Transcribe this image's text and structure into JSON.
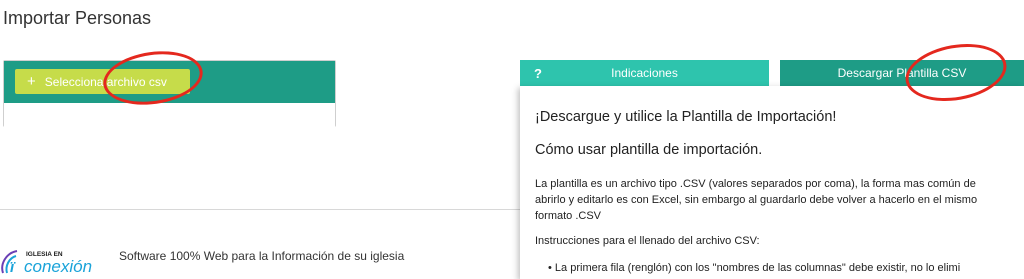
{
  "page": {
    "title": "Importar Personas"
  },
  "upload": {
    "button_label": "Selecciona archivo csv",
    "plus_icon": "+"
  },
  "tabs": {
    "info_icon": "?",
    "info_label": "Indicaciones",
    "download_label": "Descargar Plantilla CSV"
  },
  "info": {
    "heading": "¡Descargue y utilice la Plantilla de Importación!",
    "subheading": "Cómo usar plantilla de importación.",
    "para_line1": "La plantilla es un archivo tipo .CSV (valores separados por coma), la forma mas común de",
    "para_line2": "abrirlo y editarlo es con Excel, sin embargo al guardarlo debe volver a hacerlo en el mismo",
    "para_line3": "formato .CSV",
    "instructions": "Instrucciones para el llenado del archivo CSV:",
    "bullet1": "La primera fila (renglón) con los \"nombres de las columnas\" debe existir, no lo elimi"
  },
  "footer": {
    "logo_small": "IGLESIA EN",
    "logo_big": "conexión",
    "text": "Software 100% Web para la Información de su iglesia"
  },
  "colors": {
    "primary": "#1e9c86",
    "secondary": "#2ec4ad",
    "button": "#c6dc4a",
    "annotation": "#e4281e"
  }
}
